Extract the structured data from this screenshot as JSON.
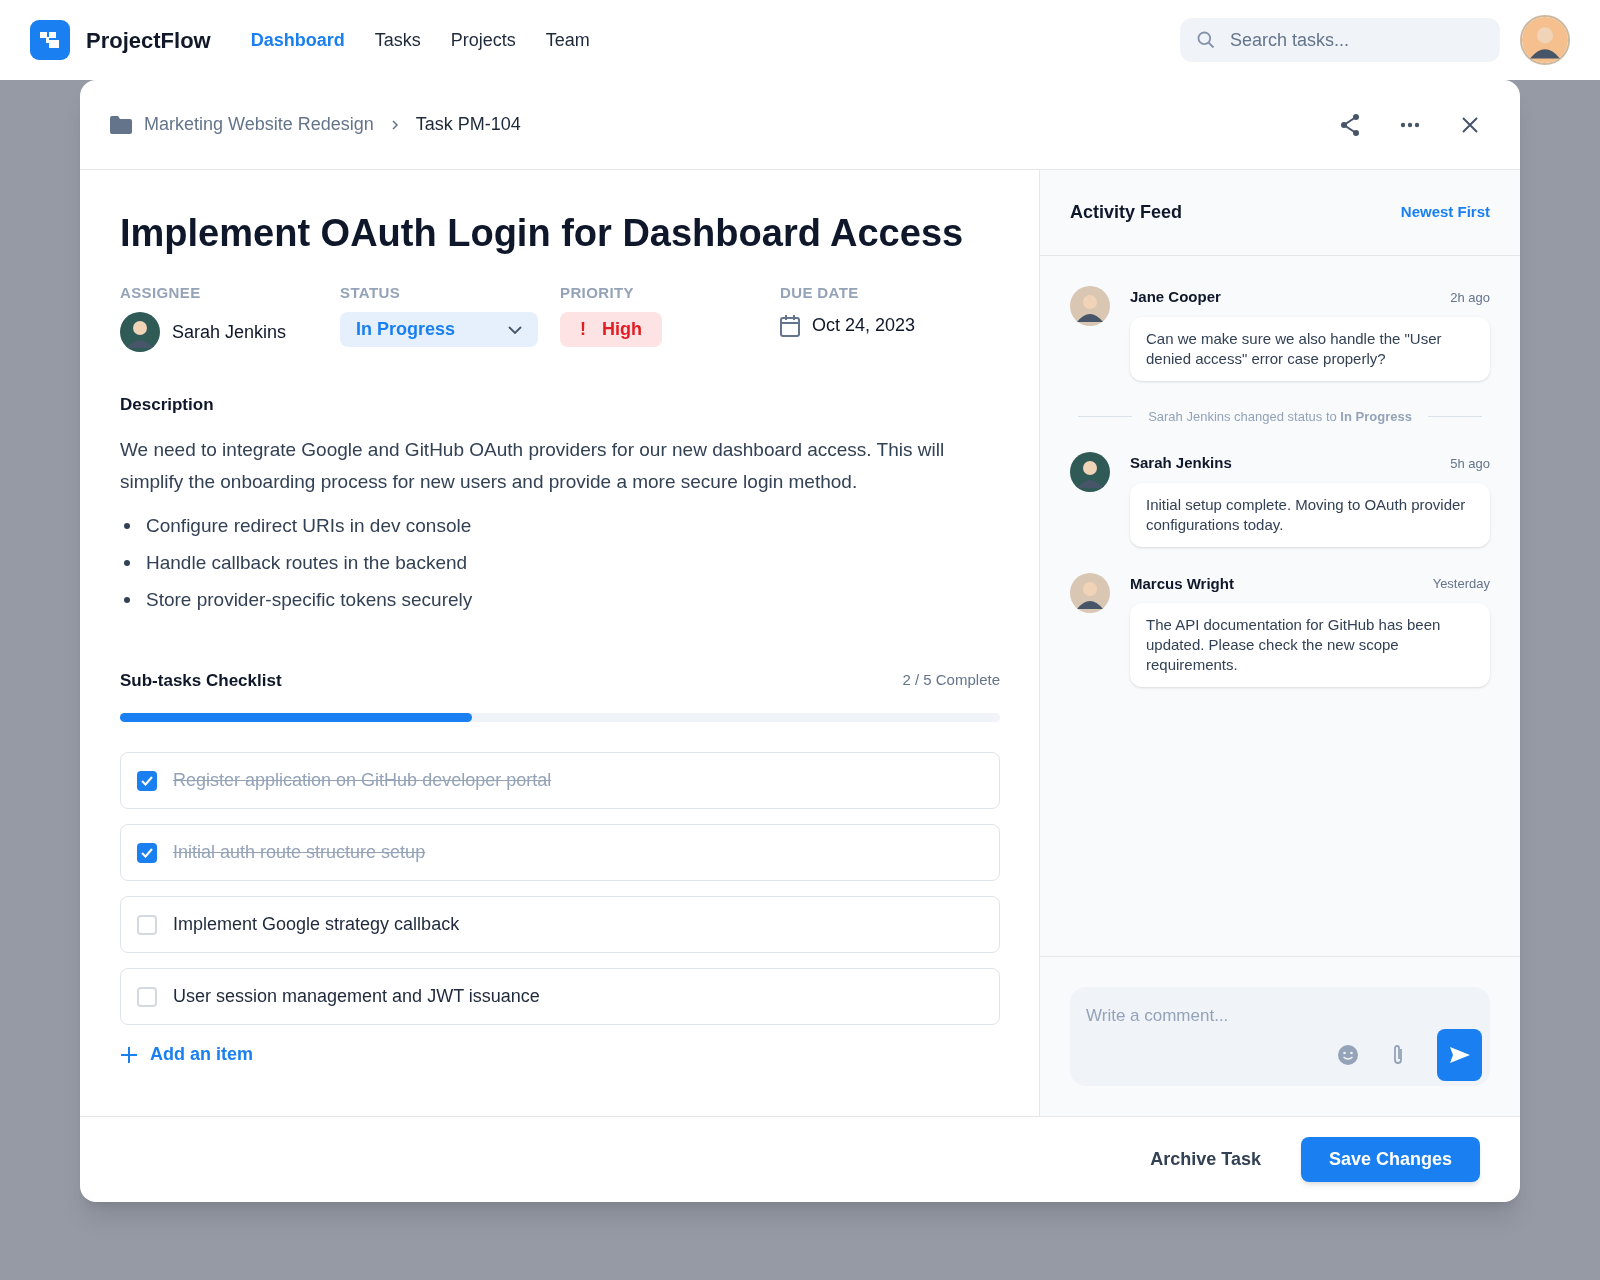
{
  "app": {
    "name": "ProjectFlow",
    "search_placeholder": "Search tasks..."
  },
  "nav": [
    {
      "label": "Dashboard",
      "selected": true
    },
    {
      "label": "Tasks",
      "selected": false
    },
    {
      "label": "Projects",
      "selected": false
    },
    {
      "label": "Team",
      "selected": false
    }
  ],
  "breadcrumb": {
    "project": "Marketing Website Redesign",
    "task": "Task PM-104"
  },
  "task": {
    "title": "Implement OAuth Login for Dashboard Access",
    "fields": {
      "assignee_label": "ASSIGNEE",
      "assignee": "Sarah Jenkins",
      "status_label": "STATUS",
      "status": "In Progress",
      "priority_label": "PRIORITY",
      "priority_mark": "!",
      "priority": "High",
      "due_label": "DUE DATE",
      "due": "Oct 24, 2023"
    },
    "description_heading": "Description",
    "description": "We need to integrate Google and GitHub OAuth providers for our new dashboard access. This will simplify the onboarding process for new users and provide a more secure login method.",
    "bullets": [
      "Configure redirect URIs in dev console",
      "Handle callback routes in the backend",
      "Store provider-specific tokens securely"
    ]
  },
  "checklist": {
    "heading": "Sub-tasks Checklist",
    "count": "2 / 5 Complete",
    "level": 0.4,
    "items": [
      {
        "label": "Register application on GitHub developer portal",
        "checked": true
      },
      {
        "label": "Initial auth route structure setup",
        "checked": true
      },
      {
        "label": "Implement Google strategy callback",
        "checked": false
      },
      {
        "label": "User session management and JWT issuance",
        "checked": false
      }
    ],
    "add_label": "Add an item"
  },
  "activity": {
    "title": "Activity Feed",
    "sort": "Newest First",
    "entries": [
      {
        "kind": "comment",
        "author": "Jane Cooper",
        "time": "2h ago",
        "text": "Can we make sure we also handle the \"User denied access\" error case properly?"
      },
      {
        "kind": "event",
        "text": "Sarah Jenkins changed status to **In Progress**"
      },
      {
        "kind": "comment",
        "author": "Sarah Jenkins",
        "time": "5h ago",
        "text": "Initial setup complete. Moving to OAuth provider configurations today."
      },
      {
        "kind": "comment",
        "author": "Marcus Wright",
        "time": "Yesterday",
        "text": "The API documentation for GitHub has been updated. Please check the new scope requirements."
      }
    ],
    "comment_placeholder": "Write a comment..."
  },
  "footer": {
    "archive": "Archive Task",
    "save": "Save Changes"
  }
}
